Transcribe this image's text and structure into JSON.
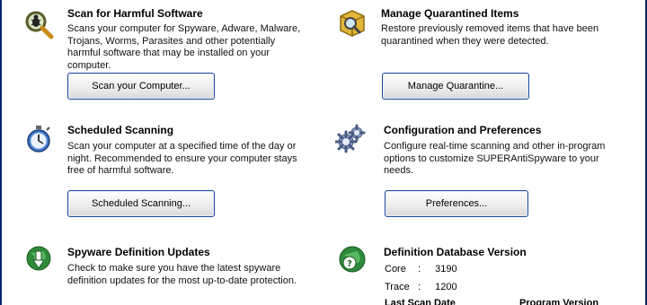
{
  "scan": {
    "title": "Scan for Harmful Software",
    "desc": "Scans your computer for Spyware, Adware, Malware, Trojans, Worms, Parasites and other potentially harmful software that may be installed on your computer.",
    "button": "Scan your Computer...",
    "icon": "magnifier-bug-icon"
  },
  "quarantine": {
    "title": "Manage Quarantined Items",
    "desc": "Restore previously removed items that have been quarantined when they were detected.",
    "button": "Manage Quarantine...",
    "icon": "quarantine-box-icon"
  },
  "scheduled": {
    "title": "Scheduled Scanning",
    "desc": "Scan your computer at a specified time of the day or night. Recommended to ensure your computer stays free of harmful software.",
    "button": "Scheduled Scanning...",
    "icon": "stopwatch-icon"
  },
  "config": {
    "title": "Configuration and Preferences",
    "desc": "Configure real-time scanning and other in-program options to customize SUPERAntiSpyware to your needs.",
    "button": "Preferences...",
    "icon": "gears-icon"
  },
  "updates": {
    "title": "Spyware Definition Updates",
    "desc": "Check to make sure you have the latest spyware definition updates for the most up-to-date protection.",
    "icon": "globe-download-icon"
  },
  "definitions": {
    "title": "Definition Database Version",
    "core_label": "Core",
    "core_value": "3190",
    "trace_label": "Trace",
    "trace_value": "1200",
    "sep": ":",
    "last_scan_label": "Last Scan Date",
    "program_version_label": "Program Version",
    "icon": "globe-question-icon"
  },
  "colors": {
    "button_border": "#1c4a9c",
    "frame": "#0a246a"
  }
}
